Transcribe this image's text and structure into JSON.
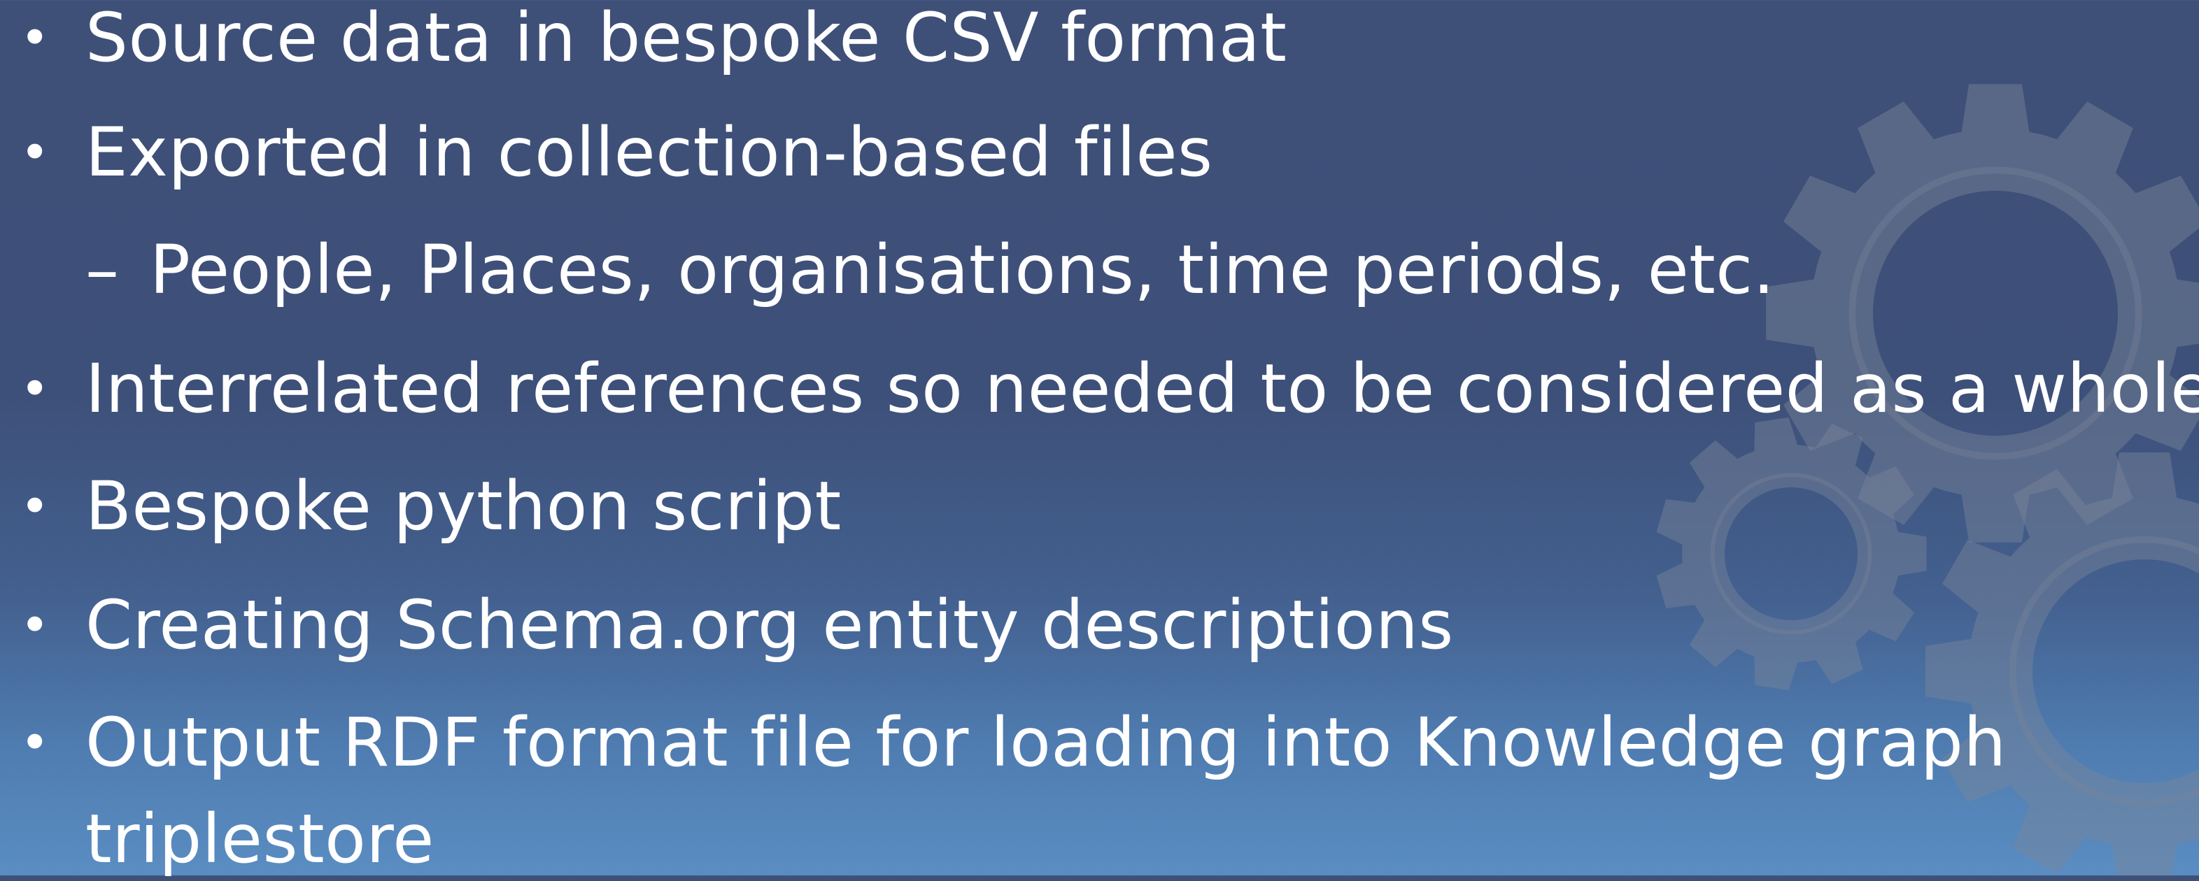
{
  "bullets": {
    "b1": "Source data in bespoke CSV format",
    "b2": "Exported in collection-based files",
    "b2_sub1": "People, Places, organisations, time periods, etc.",
    "b3": "Interrelated references so needed to be considered as a whole",
    "b4": "Bespoke python script",
    "b5": "Creating Schema.org entity descriptions",
    "b6_line1": "Output RDF format file for loading into Knowledge graph",
    "b6_line2": "triplestore"
  },
  "markers": {
    "bullet": "•",
    "dash": "–"
  },
  "icons": {
    "decoration": "gear-icon"
  },
  "colors": {
    "background_top": "#3f5078",
    "background_bottom": "#5a8dc2",
    "gear_fill": "#7a8498",
    "text": "#ffffff"
  }
}
